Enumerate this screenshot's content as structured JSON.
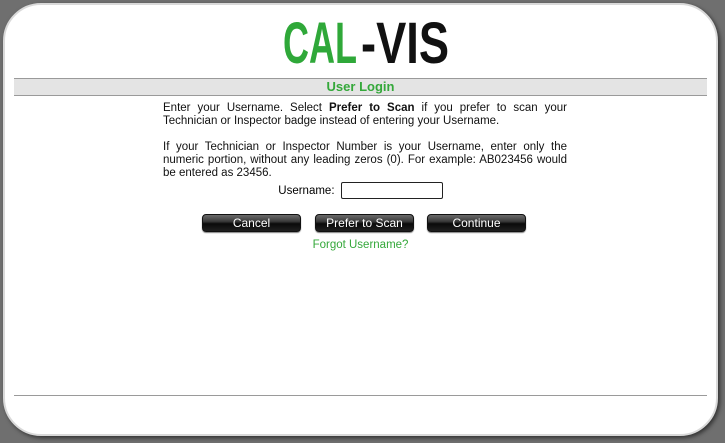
{
  "logo": {
    "text_left": "CAL",
    "text_right": "-VIS",
    "colors": {
      "green": "#2fa839",
      "black": "#111111"
    }
  },
  "header": {
    "title": "User Login",
    "title_color": "#34a83a"
  },
  "instructions": {
    "para1_a": "Enter your Username. Select ",
    "para1_bold": "Prefer to Scan",
    "para1_b": " if you prefer to scan your Technician or Inspector badge instead of entering your Username.",
    "para2": "If your Technician or Inspector Number is your Username, enter only the numeric portion, without any leading zeros (0). For example: AB023456 would be entered as 23456."
  },
  "form": {
    "username_label": "Username:",
    "username_value": "",
    "cancel_label": "Cancel",
    "scan_label": "Prefer to Scan",
    "continue_label": "Continue",
    "forgot_label": "Forgot Username?"
  }
}
